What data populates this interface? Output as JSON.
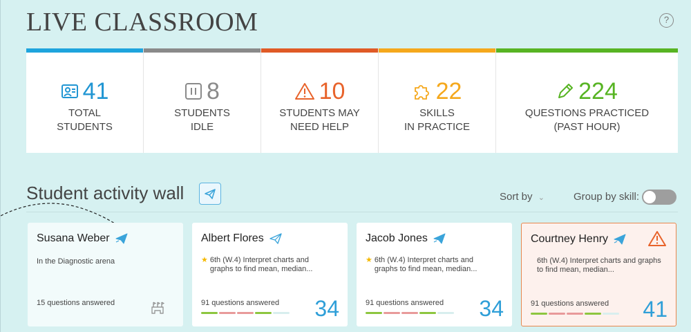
{
  "header": {
    "title": "LIVE CLASSROOM",
    "help_icon": "?"
  },
  "stats": [
    {
      "value": "41",
      "label": "TOTAL\nSTUDENTS",
      "icon": "students-icon",
      "color": "#2196d3"
    },
    {
      "value": "8",
      "label": "STUDENTS\nIDLE",
      "icon": "pause-icon",
      "color": "#8a8a8a"
    },
    {
      "value": "10",
      "label": "STUDENTS MAY\nNEED HELP",
      "icon": "warning-icon",
      "color": "#e8632b"
    },
    {
      "value": "22",
      "label": "SKILLS\nIN PRACTICE",
      "icon": "puzzle-icon",
      "color": "#f5a81c"
    },
    {
      "value": "224",
      "label": "QUESTIONS PRACTICED\n(PAST HOUR)",
      "icon": "pencil-icon",
      "color": "#57b423"
    }
  ],
  "wall": {
    "title": "Student activity wall",
    "sort_label": "Sort by",
    "group_label": "Group by skill:",
    "group_toggle_on": false
  },
  "cards": [
    {
      "name": "Susana Weber",
      "status": "In the Diagnostic arena",
      "answered": "15 questions answered"
    },
    {
      "name": "Albert Flores",
      "skill": "6th (W.4) Interpret charts and graphs  to find mean, median...",
      "answered": "91 questions answered",
      "count": "34"
    },
    {
      "name": "Jacob Jones",
      "skill": "6th (W.4) Interpret charts and graphs  to find mean, median...",
      "answered": "91 questions answered",
      "count": "34"
    },
    {
      "name": "Courtney Henry",
      "skill": "6th (W.4) Interpret charts and graphs  to find mean, median...",
      "answered": "91 questions answered",
      "count": "41"
    }
  ],
  "colors": {
    "green": "#8dc63f",
    "red": "#e89a9a",
    "light": "#d8eeee",
    "accent": "#2f9fd8",
    "alert": "#e8632b"
  }
}
